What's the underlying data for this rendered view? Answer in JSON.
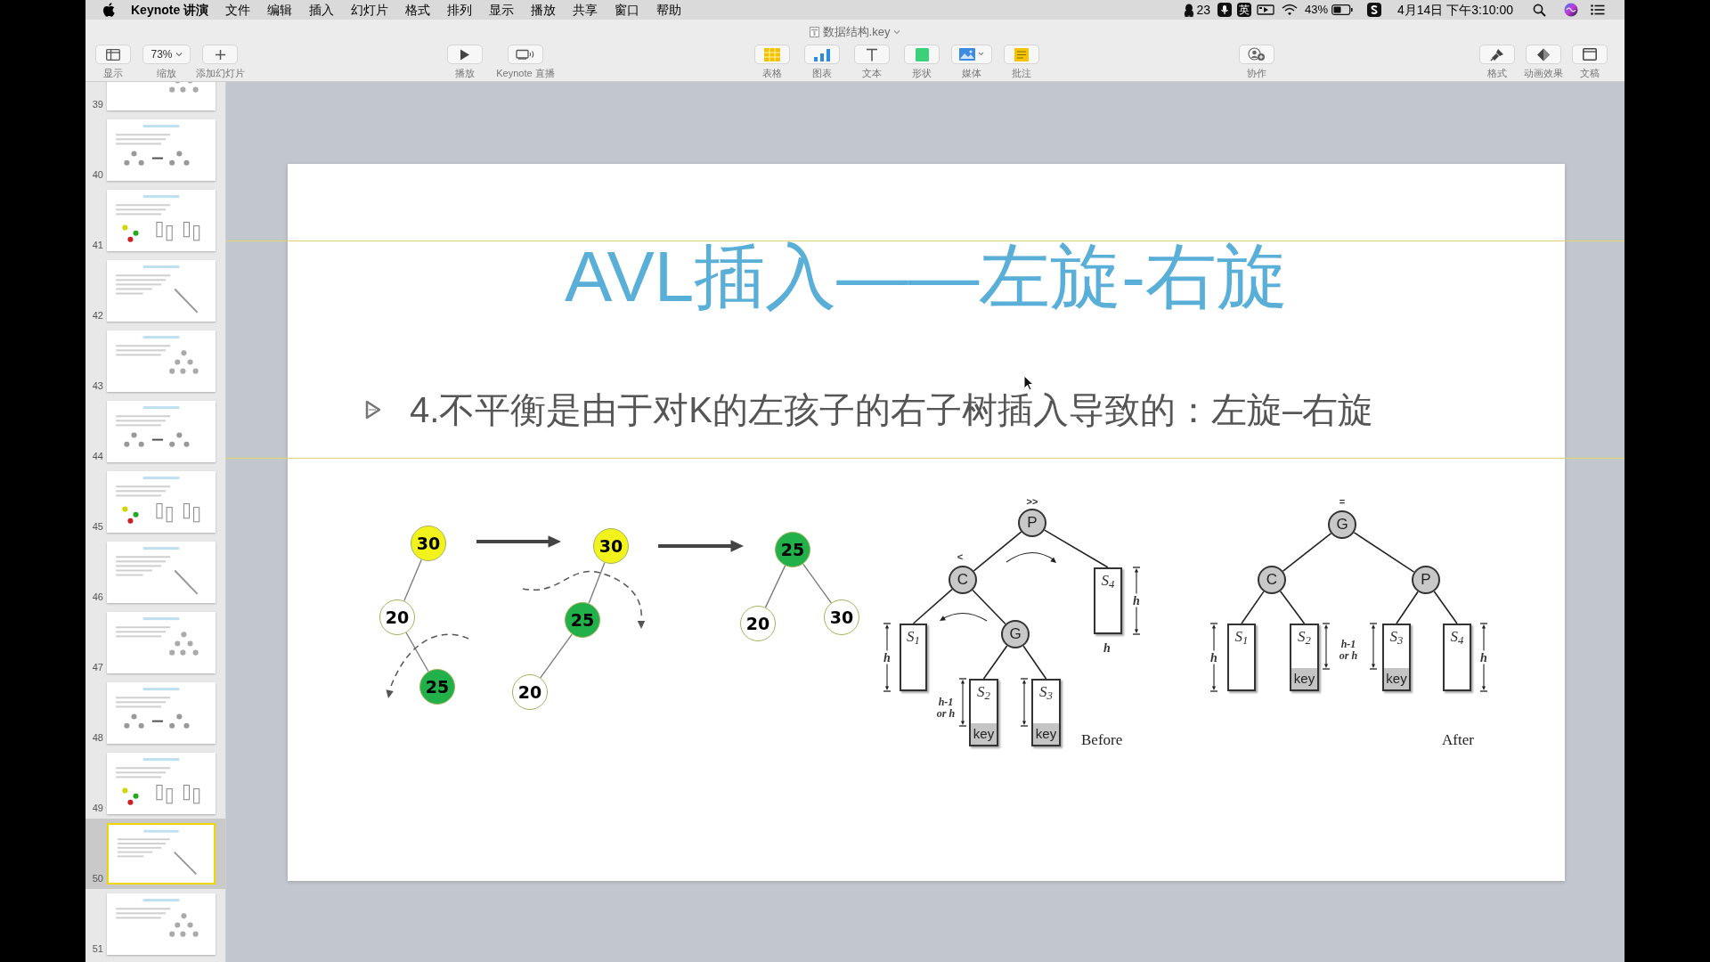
{
  "menu_bar": {
    "app_name": "Keynote 讲演",
    "menus": [
      "文件",
      "编辑",
      "插入",
      "幻灯片",
      "格式",
      "排列",
      "显示",
      "播放",
      "共享",
      "窗口",
      "帮助"
    ],
    "status": {
      "notification_count": "23",
      "input_method": "英",
      "battery": "43%",
      "datetime": "4月14日 下午3:10:00"
    }
  },
  "window": {
    "title": "数据结构.key"
  },
  "toolbar": {
    "groups": [
      {
        "items": [
          {
            "label": "显示"
          },
          {
            "label": "缩放",
            "value": "73%"
          },
          {
            "label": "添加幻灯片"
          }
        ]
      },
      {
        "items": [
          {
            "label": "播放"
          },
          {
            "label": "Keynote 直播"
          }
        ]
      },
      {
        "items": [
          {
            "label": "表格"
          },
          {
            "label": "图表"
          },
          {
            "label": "文本"
          },
          {
            "label": "形状"
          },
          {
            "label": "媒体"
          },
          {
            "label": "批注"
          }
        ]
      },
      {
        "items": [
          {
            "label": "协作"
          }
        ]
      },
      {
        "items": [
          {
            "label": "格式"
          },
          {
            "label": "动画效果"
          },
          {
            "label": "文稿"
          }
        ]
      }
    ]
  },
  "sidebar": {
    "slides": [
      {
        "number": "39",
        "selected": false
      },
      {
        "number": "40",
        "selected": false
      },
      {
        "number": "41",
        "selected": false
      },
      {
        "number": "42",
        "selected": false
      },
      {
        "number": "43",
        "selected": false
      },
      {
        "number": "44",
        "selected": false
      },
      {
        "number": "45",
        "selected": false
      },
      {
        "number": "46",
        "selected": false
      },
      {
        "number": "47",
        "selected": false
      },
      {
        "number": "48",
        "selected": false
      },
      {
        "number": "49",
        "selected": false
      },
      {
        "number": "50",
        "selected": true
      },
      {
        "number": "51",
        "selected": false
      }
    ]
  },
  "slide": {
    "title": "AVL插入——左旋-右旋",
    "bullets": [
      "4.不平衡是由于对K的左孩子的右子树插入导致的：左旋–右旋"
    ],
    "rotation_steps": [
      {
        "nodes": [
          {
            "label": "30",
            "color": "#f2f21c"
          },
          {
            "label": "20",
            "color": "#ffffff"
          },
          {
            "label": "25",
            "color": "#22b04b"
          }
        ]
      },
      {
        "nodes": [
          {
            "label": "30",
            "color": "#f2f21c"
          },
          {
            "label": "25",
            "color": "#22b04b"
          },
          {
            "label": "20",
            "color": "#ffffff"
          }
        ]
      },
      {
        "nodes": [
          {
            "label": "25",
            "color": "#22b04b"
          },
          {
            "label": "20",
            "color": "#ffffff"
          },
          {
            "label": "30",
            "color": "#ffffff"
          }
        ]
      }
    ],
    "rotation_figure": {
      "before": {
        "caption": "Before",
        "balance_marks": [
          ">>",
          "<"
        ],
        "nodes": [
          "P",
          "C",
          "G"
        ],
        "subtrees": [
          {
            "label": "S$_{1}$"
          },
          {
            "label": "S$_{2}$",
            "key_label": "key"
          },
          {
            "label": "S$_{3}$",
            "key_label": "key"
          },
          {
            "label": "S$_{4}$"
          }
        ],
        "height_labels": [
          "h",
          "h-1 or h",
          "h",
          "h"
        ]
      },
      "after": {
        "caption": "After",
        "balance_marks": [
          "="
        ],
        "nodes": [
          "G",
          "C",
          "P"
        ],
        "subtrees": [
          {
            "label": "S$_{1}$"
          },
          {
            "label": "S$_{2}$",
            "key_label": "key"
          },
          {
            "label": "S$_{3}$",
            "key_label": "key"
          },
          {
            "label": "S$_{4}$"
          }
        ],
        "height_labels": [
          "h",
          "h-1 or h",
          "h"
        ]
      }
    }
  }
}
